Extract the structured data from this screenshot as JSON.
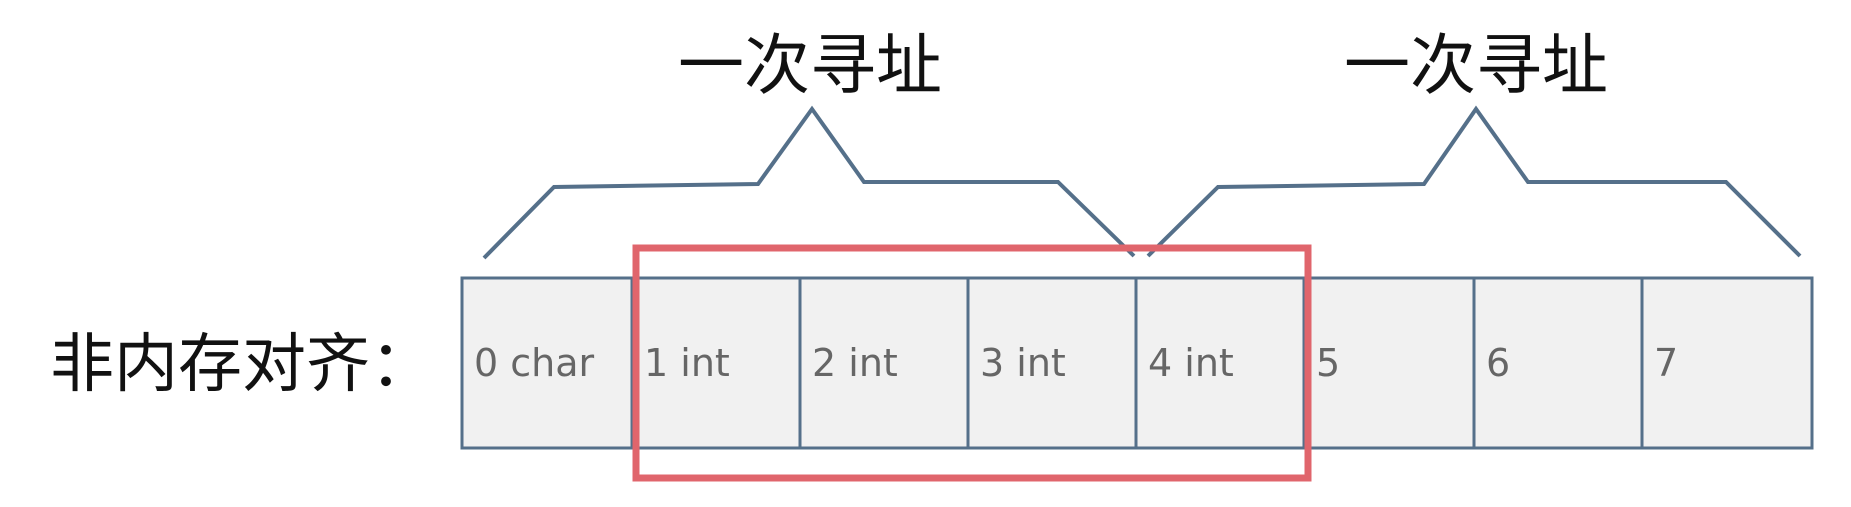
{
  "row_label": "非内存对齐：",
  "cells": [
    {
      "label": "0 char",
      "filled": true
    },
    {
      "label": "1 int",
      "filled": true
    },
    {
      "label": "2 int",
      "filled": true
    },
    {
      "label": "3 int",
      "filled": true
    },
    {
      "label": "4 int",
      "filled": true
    },
    {
      "label": "5",
      "filled": false
    },
    {
      "label": "6",
      "filled": false
    },
    {
      "label": "7",
      "filled": false
    }
  ],
  "braces": [
    {
      "label": "一次寻址",
      "span": [
        0,
        3
      ]
    },
    {
      "label": "一次寻址",
      "span": [
        4,
        7
      ]
    }
  ],
  "highlight": {
    "span": [
      1,
      4
    ]
  },
  "colors": {
    "cell_fill": "#f1f1f1",
    "cell_empty_fill": "#ffffff",
    "cell_border": "#55708a",
    "brace": "#55708a",
    "highlight": "#e0656c",
    "cell_text": "#666666",
    "label_text": "#111111"
  }
}
